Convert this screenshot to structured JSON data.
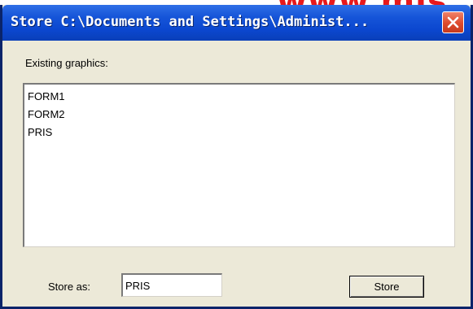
{
  "watermark": {
    "text": "www.mis"
  },
  "window": {
    "title": "Store C:\\Documents and Settings\\Administ...",
    "close_icon": "close-icon",
    "title_bar_color": "#0b47cf",
    "close_button_color": "#de4a2c"
  },
  "dialog": {
    "existing_label": "Existing graphics:",
    "list_items": [
      "FORM1",
      "FORM2",
      "PRIS"
    ],
    "store_as_label": "Store as:",
    "store_as_value": "PRIS",
    "store_button_label": "Store"
  }
}
